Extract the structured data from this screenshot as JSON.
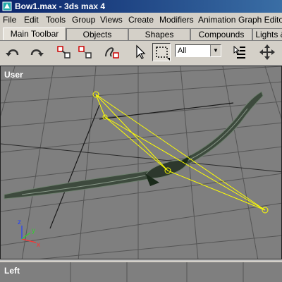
{
  "window": {
    "title": "Bow1.max - 3ds max 4"
  },
  "menu": [
    "File",
    "Edit",
    "Tools",
    "Group",
    "Views",
    "Create",
    "Modifiers",
    "Animation",
    "Graph Editors"
  ],
  "tabs": [
    "Main Toolbar",
    "Objects",
    "Shapes",
    "Compounds",
    "Lights &"
  ],
  "active_tab": "Main Toolbar",
  "toolbar": {
    "buttons": [
      "undo-icon",
      "redo-icon",
      "link-icon",
      "unlink-icon",
      "bind-space-warp-icon",
      "select-object-icon",
      "region-select-icon",
      "select-by-name-icon",
      "move-icon"
    ],
    "selection_filter": "All"
  },
  "viewports": {
    "main_label": "User",
    "bottom_label": "Left"
  },
  "axis": {
    "x": "x",
    "y": "y",
    "z": "z"
  },
  "colors": {
    "titlebar": "#0a246a",
    "viewport_bg": "#7f7f7f",
    "selection": "#ffff00"
  }
}
